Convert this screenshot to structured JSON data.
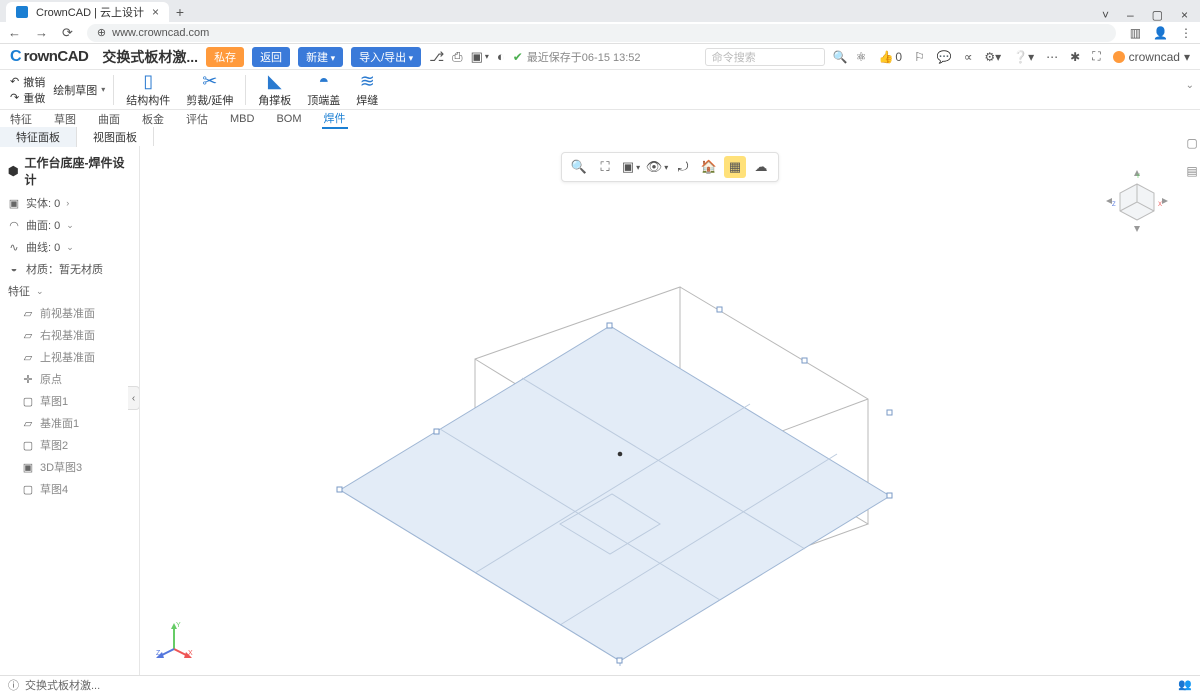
{
  "browser": {
    "tab_title": "CrownCAD | 云上设计",
    "url": "www.crowncad.com"
  },
  "app": {
    "logo": "CrownCAD",
    "doc_title": "交换式板材激...",
    "pill_save": "私存",
    "pill_return": "返回",
    "pill_new": "新建",
    "pill_import": "导入/导出",
    "save_status": "最近保存于06-15 13:52",
    "cmd_placeholder": "命令搜索",
    "thumbs_up": "0",
    "username": "crowncad"
  },
  "toolbar2": {
    "undo": "撤销",
    "redo": "重做",
    "sketch_dd": "绘制草图",
    "struct": "结构构件",
    "trim": "剪裁/延伸",
    "gusset": "角撑板",
    "endcap": "顶端盖",
    "weld": "焊缝"
  },
  "ribbon": {
    "tabs": [
      "特征",
      "草图",
      "曲面",
      "板金",
      "评估",
      "MBD",
      "BOM",
      "焊件"
    ],
    "active": "焊件"
  },
  "subtabs": {
    "tabs": [
      "特征面板",
      "视图面板"
    ],
    "active": "特征面板"
  },
  "tree": {
    "title": "工作台底座-焊件设计",
    "entity": "实体: 0",
    "face": "曲面: 0",
    "curve": "曲线: 0",
    "material": "材质：暂无材质",
    "features": "特征",
    "items": [
      "前视基准面",
      "右视基准面",
      "上视基准面",
      "原点",
      "草图1",
      "基准面1",
      "草图2",
      "3D草图3",
      "草图4"
    ]
  },
  "status": {
    "doc": "交换式板材激..."
  },
  "icons": {
    "search": "search-icon",
    "globe": "globe-icon",
    "mic": "mic-icon",
    "thumbs": "thumbs-icon",
    "cube": "cube-icon",
    "eye": "eye-icon",
    "home": "home-icon"
  }
}
